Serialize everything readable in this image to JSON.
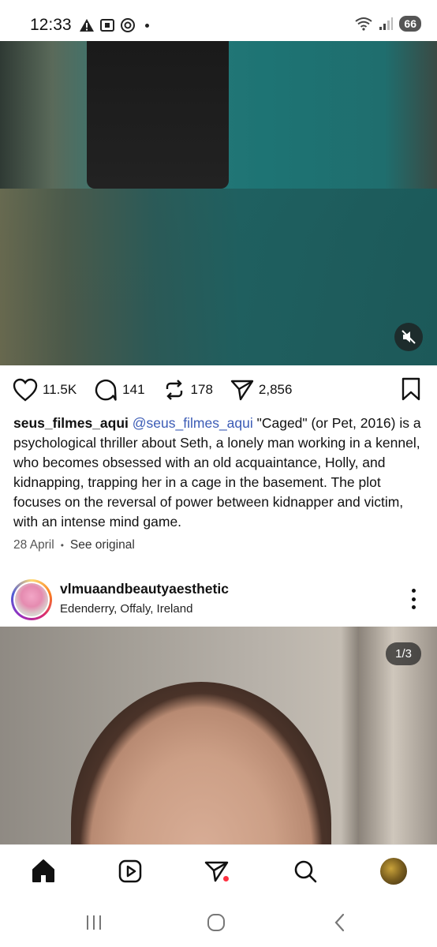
{
  "status_bar": {
    "time": "12:33",
    "battery": "66",
    "icons_left": [
      "warning-icon",
      "screenshot-icon",
      "at-icon",
      "dot-icon"
    ],
    "icons_right": [
      "wifi-icon",
      "signal-icon"
    ]
  },
  "post1": {
    "actions": {
      "likes": "11.5K",
      "comments": "141",
      "reposts": "178",
      "shares": "2,856"
    },
    "caption": {
      "username": "seus_filmes_aqui",
      "mention": "@seus_filmes_aqui",
      "text": " \"Caged\" (or Pet, 2016) is a psychological thriller about Seth, a lonely man working in a kennel, who becomes obsessed with an old acquaintance, Holly, and kidnapping, trapping her in a cage in the basement. The plot focuses on the reversal of power between kidnapper and victim, with an intense mind game."
    },
    "date": "28 April",
    "separator": "•",
    "see_original": "See original"
  },
  "post2": {
    "username": "vlmuaandbeautyaesthetic",
    "location": "Edenderry, Offaly, Ireland",
    "page_indicator": "1/3"
  },
  "bottom_nav": [
    "home-icon",
    "reels-icon",
    "direct-icon",
    "search-icon",
    "profile-avatar"
  ],
  "colors": {
    "mention": "#3b5bb5",
    "notification_dot": "#ff3040"
  }
}
